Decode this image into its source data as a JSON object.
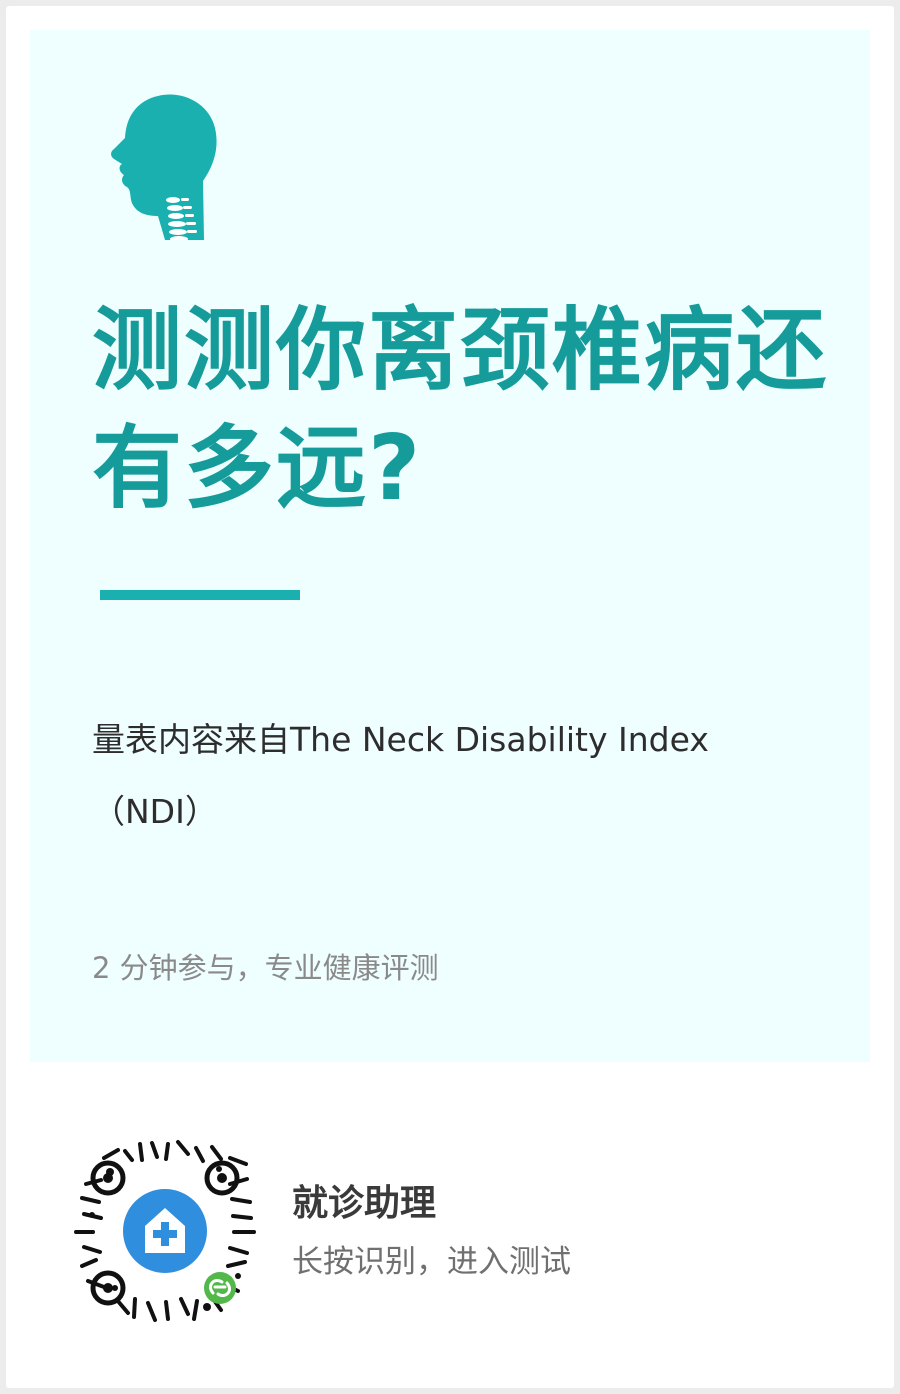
{
  "hero": {
    "title": "测测你离颈椎病还有多远?",
    "source_text": "量表内容来自The Neck Disability Index（NDI）",
    "meta_text": "2 分钟参与，专业健康评测",
    "head_icon": "head-spine-icon"
  },
  "footer": {
    "title": "就诊助理",
    "subtitle": "长按识别，进入测试",
    "qr_icon": "mini-program-qr-code",
    "center_icon": "medical-house-icon",
    "badge_icon": "mini-program-link-icon"
  },
  "colors": {
    "page_background": "#ececec",
    "card_background": "#ffffff",
    "hero_background": "#effefe",
    "accent": "#169b9b",
    "divider": "#1ab0b0",
    "qr_center": "#2f8fde",
    "mini_program_badge": "#52b84a"
  }
}
